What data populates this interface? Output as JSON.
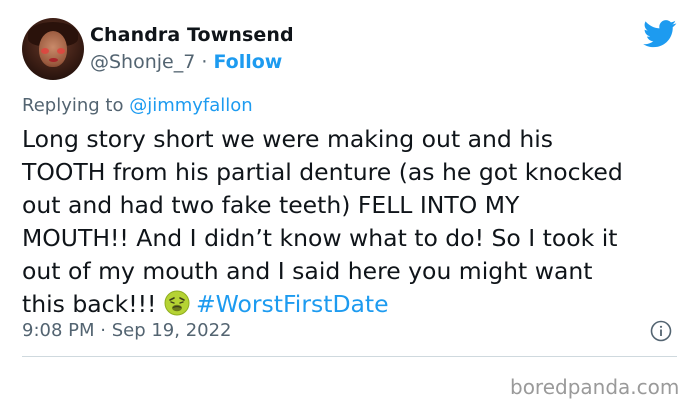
{
  "user": {
    "name": "Chandra Townsend",
    "handle": "@Shonje_7",
    "separator": " · ",
    "follow_label": "Follow"
  },
  "reply": {
    "prefix": "Replying to ",
    "mention": "@jimmyfallon"
  },
  "tweet": {
    "text": "Long story short we were making out and his\nTOOTH from his partial denture (as he got knocked\nout and had two fake teeth)  FELL INTO MY\nMOUTH!! And I didn’t know what to do! So I took it\nout of my mouth and I said here you might want\nthis back!!! ",
    "emoji_icon": "nauseated-face-emoji",
    "hashtag": "#WorstFirstDate"
  },
  "meta": {
    "timestamp": "9:08 PM · Sep 19, 2022"
  },
  "watermark": "boredpanda.com",
  "colors": {
    "accent": "#1d9bf0",
    "secondary_text": "#536471",
    "primary_text": "#0f1419"
  },
  "icons": {
    "brand": "twitter-bird-icon",
    "info": "info-icon"
  }
}
